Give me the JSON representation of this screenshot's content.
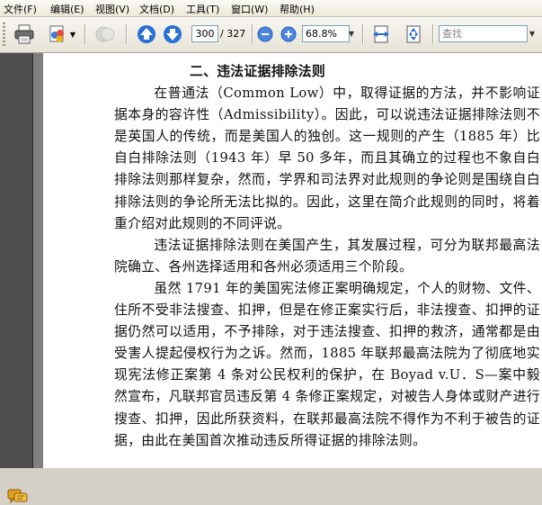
{
  "menu": [
    {
      "label": "文件(F)"
    },
    {
      "label": "编辑(E)"
    },
    {
      "label": "视图(V)"
    },
    {
      "label": "文档(D)"
    },
    {
      "label": "工具(T)"
    },
    {
      "label": "窗口(W)"
    },
    {
      "label": "帮助(H)"
    }
  ],
  "toolbar": {
    "current_page": "300",
    "total_pages": "/ 327",
    "zoom": "68.8%",
    "search_placeholder": "查找"
  },
  "icons": {
    "print": "print-icon",
    "collaborate": "collaborate-icon",
    "comment": "comment-icon",
    "prev": "arrow-up-icon",
    "next": "arrow-down-icon",
    "zoom_out": "minus-icon",
    "zoom_in": "plus-icon",
    "fit_width": "fit-width-icon",
    "fit_page": "fit-page-icon",
    "sidebar_comment": "comments-icon"
  },
  "colors": {
    "accent": "#2a6fd6",
    "panel": "#4e4e4e",
    "comment_icon": "#e0a020"
  },
  "document": {
    "heading": "二、违法证据排除法则",
    "paragraphs": [
      "在普通法（Common Low）中，取得证据的方法，并不影响证据本身的容许性（Admissibility）。因此，可以说违法证据排除法则不是英国人的传统，而是美国人的独创。这一规则的产生（1885 年）比自白排除法则（1943 年）早 50 多年，而且其确立的过程也不象自白排除法则那样复杂，然而，学界和司法界对此规则的争论则是围绕自白排除法则的争论所无法比拟的。因此，这里在简介此规则的同时，将着重介绍对此规则的不同评说。",
      "违法证据排除法则在美国产生，其发展过程，可分为联邦最高法院确立、各州选择适用和各州必须适用三个阶段。",
      "虽然 1791 年的美国宪法修正案明确规定，个人的财物、文件、住所不受非法搜查、扣押，但是在修正案实行后，非法搜查、扣押的证据仍然可以适用，不予排除，对于违法搜查、扣押的救济，通常都是由受害人提起侵权行为之诉。然而，1885 年联邦最高法院为了彻底地实现宪法修正案第 4 条对公民权利的保护，在 Boyad v.U．S—案中毅然宣布，凡联邦官员违反第 4 条修正案规定，对被告人身体或财产进行搜查、扣押，因此所获资料，在联邦最高法院不得作为不利于被告的证据，由此在美国首次推动违反所得证据的排除法则。"
    ]
  }
}
